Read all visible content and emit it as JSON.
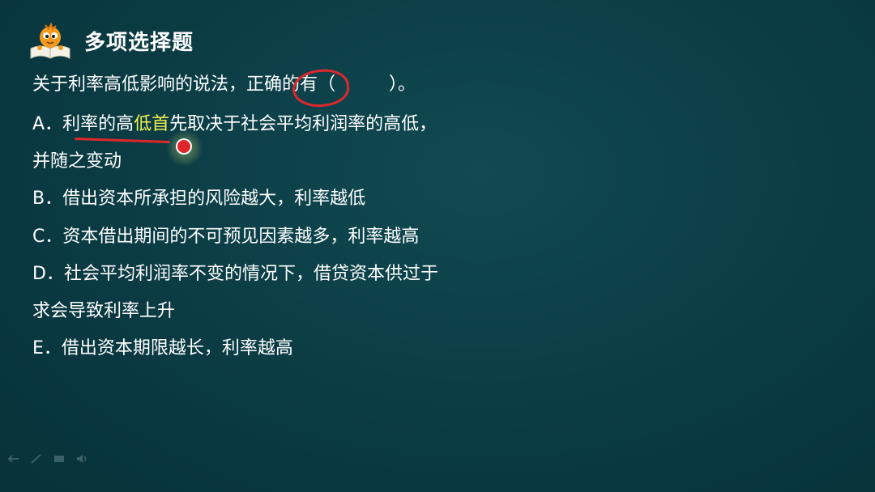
{
  "header": {
    "title": "多项选择题",
    "icon": "mascot-book-icon"
  },
  "question": {
    "text_before": "关于利率高低影响的说法，",
    "text_circled": "正确",
    "text_after": "的有（　　　）。"
  },
  "options": {
    "a_prefix": "A．",
    "a_line1_part1": "利率的高",
    "a_line1_highlight": "低首",
    "a_line1_part2": "先取决于社会平均利润率的高低，",
    "a_line2": "并随之变动",
    "b": "B．借出资本所承担的风险越大，利率越低",
    "c": "C．资本借出期间的不可预见因素越多，利率越高",
    "d_line1": "D．社会平均利润率不变的情况下，借贷资本供过于",
    "d_line2": "求会导致利率上升",
    "e": "E．借出资本期限越长，利率越高"
  },
  "toolbar": {
    "icons": [
      "arrow-icon",
      "pen-icon",
      "screen-icon",
      "speaker-icon"
    ]
  },
  "colors": {
    "background": "#0b3b43",
    "annotation_red": "#e0282c",
    "highlight_yellow": "#f3ef52",
    "text": "#ffffff"
  }
}
